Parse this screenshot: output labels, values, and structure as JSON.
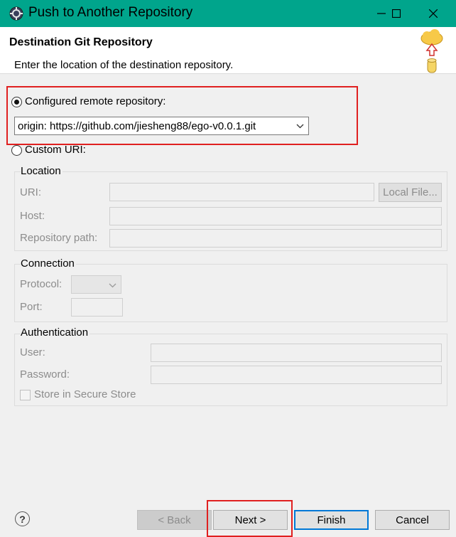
{
  "window": {
    "title": "Push to Another Repository",
    "app_icon": "eclipse-gear-icon",
    "title_bar_color": "#00a58c"
  },
  "header": {
    "title": "Destination Git Repository",
    "description": "Enter the location of the destination repository.",
    "icon": "cloud-upload-repository-icon"
  },
  "configured_remote": {
    "label": "Configured remote repository:",
    "selected": true,
    "value": "origin: https://github.com/jiesheng88/ego-v0.0.1.git"
  },
  "custom_uri": {
    "label": "Custom URI:",
    "selected": false
  },
  "location": {
    "title": "Location",
    "uri_label": "URI:",
    "uri_value": "",
    "local_file_button": "Local File...",
    "host_label": "Host:",
    "host_value": "",
    "repo_path_label": "Repository path:",
    "repo_path_value": ""
  },
  "connection": {
    "title": "Connection",
    "protocol_label": "Protocol:",
    "protocol_value": "",
    "port_label": "Port:",
    "port_value": ""
  },
  "authentication": {
    "title": "Authentication",
    "user_label": "User:",
    "user_value": "",
    "password_label": "Password:",
    "password_value": "",
    "store_label": "Store in Secure Store",
    "store_checked": false
  },
  "footer": {
    "help": "?",
    "back": "< Back",
    "next": "Next >",
    "finish": "Finish",
    "cancel": "Cancel"
  },
  "highlight_color": "#e02020"
}
